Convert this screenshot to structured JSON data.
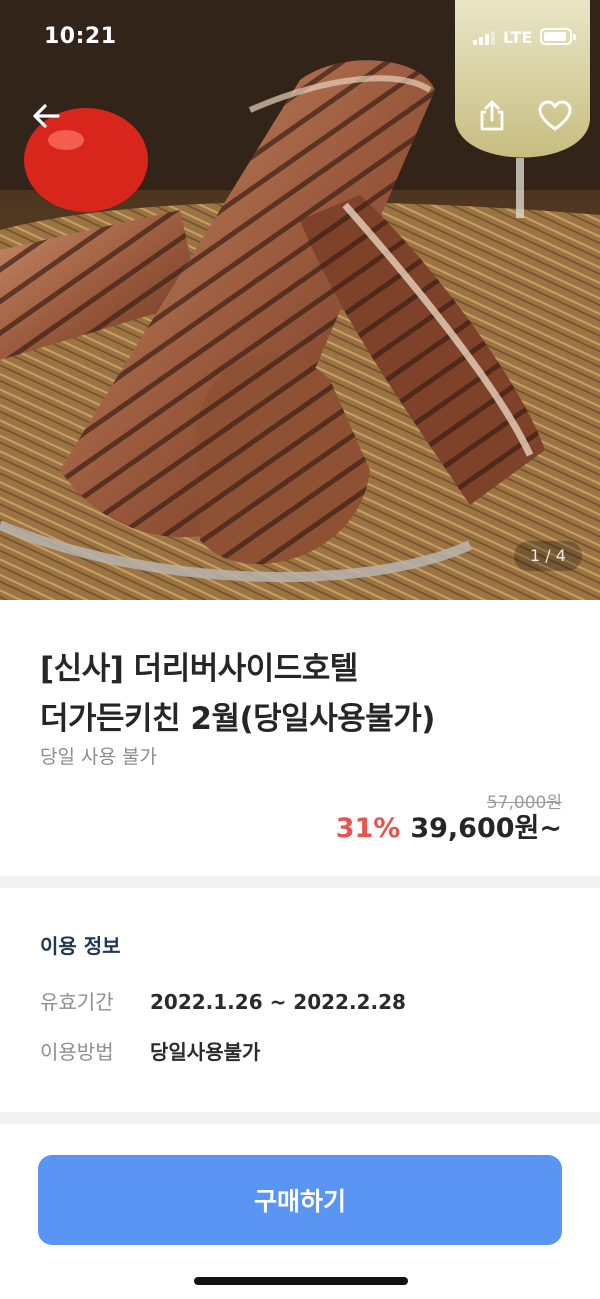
{
  "status_bar": {
    "time": "10:21",
    "network": "LTE"
  },
  "hero": {
    "pager": "1 / 4"
  },
  "product": {
    "title_line1": "[신사] 더리버사이드호텔",
    "title_line2": "더가든키친 2월(당일사용불가)",
    "subtitle": "당일 사용 불가",
    "original_price": "57,000원",
    "discount": "31%",
    "price": "39,600원~",
    "discount_color": "#e8554f"
  },
  "usage_info": {
    "heading": "이용 정보",
    "rows": [
      {
        "label": "유효기간",
        "value": "2022.1.26 ~ 2022.2.28"
      },
      {
        "label": "이용방법",
        "value": "당일사용불가"
      }
    ]
  },
  "footer": {
    "buy_label": "구매하기",
    "buy_color": "#5b95f4"
  },
  "icons": {
    "back": "arrow-left-icon",
    "share": "share-icon",
    "like": "heart-icon"
  }
}
